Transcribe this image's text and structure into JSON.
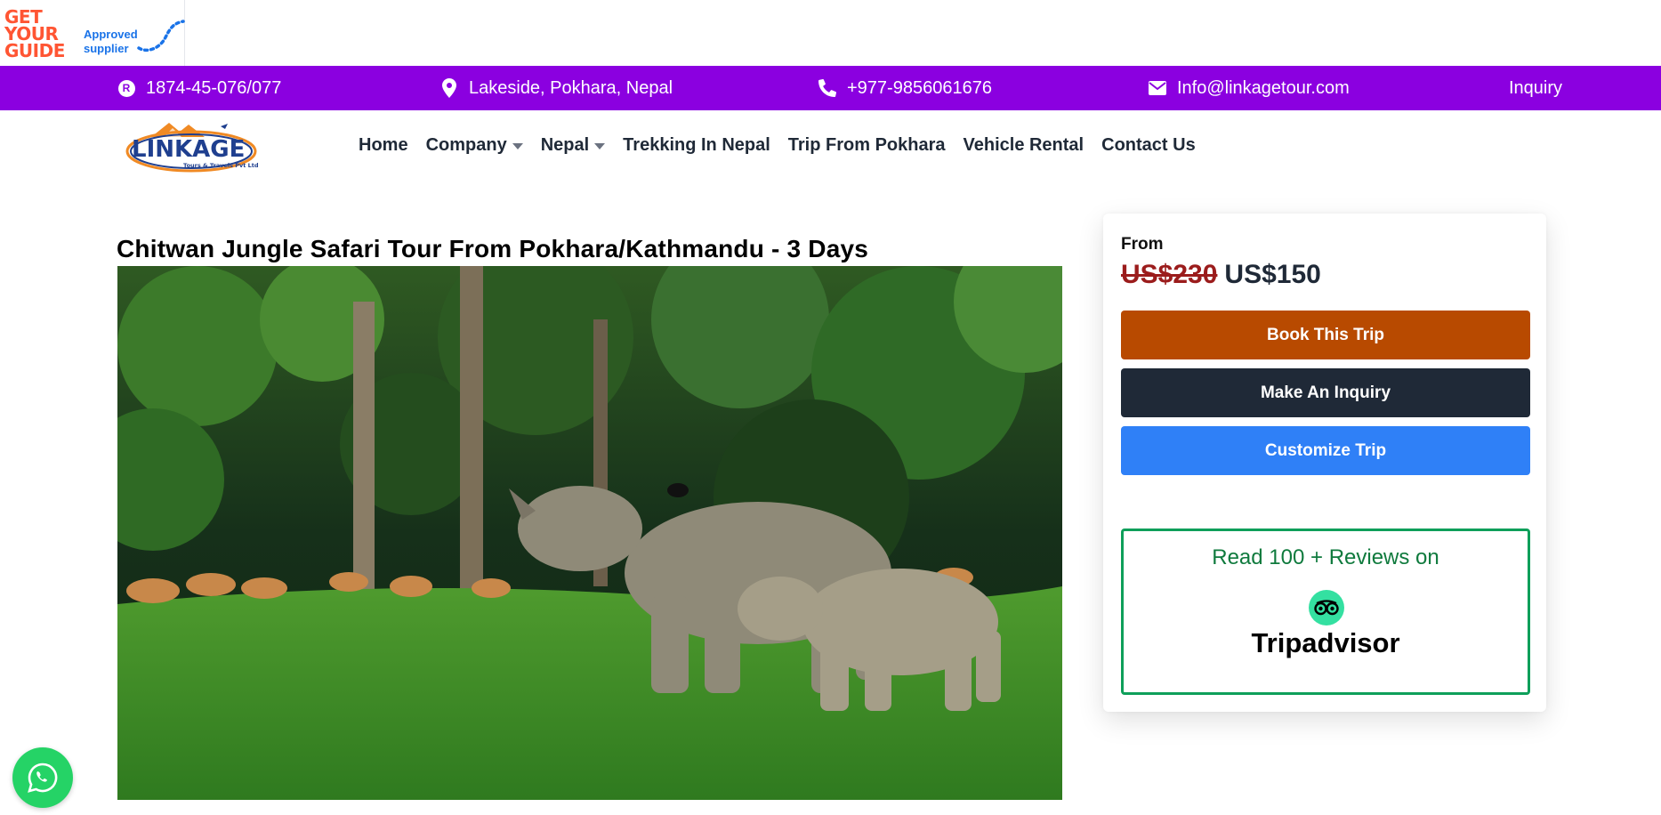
{
  "gyg": {
    "logo_text": "GET YOUR GUIDE",
    "approved_line1": "Approved",
    "approved_line2": "supplier"
  },
  "topbar": {
    "registration": "1874-45-076/077",
    "registration_icon": "registered-icon",
    "address": "Lakeside, Pokhara, Nepal",
    "phone": "+977-9856061676",
    "email": "Info@linkagetour.com",
    "inquiry": "Inquiry",
    "background_color": "#8b00e0"
  },
  "brand": {
    "name": "LINKAGE",
    "tagline": "Tours & Travels Pvt Ltd"
  },
  "nav": {
    "items": [
      {
        "label": "Home",
        "has_dropdown": false
      },
      {
        "label": "Company",
        "has_dropdown": true
      },
      {
        "label": "Nepal",
        "has_dropdown": true
      },
      {
        "label": "Trekking In Nepal",
        "has_dropdown": false
      },
      {
        "label": "Trip From Pokhara",
        "has_dropdown": false
      },
      {
        "label": "Vehicle Rental",
        "has_dropdown": false
      },
      {
        "label": "Contact Us",
        "has_dropdown": false
      }
    ]
  },
  "page": {
    "title": "Chitwan Jungle Safari Tour From Pokhara/Kathmandu - 3 Days",
    "hero_alt": "Rhinos and deer in Chitwan grassland"
  },
  "booking": {
    "from_label": "From",
    "old_price": "US$230",
    "new_price": "US$150",
    "book_label": "Book This Trip",
    "inquiry_label": "Make An Inquiry",
    "customize_label": "Customize Trip",
    "colors": {
      "book": "#b84a00",
      "inquiry": "#1f2937",
      "customize": "#2f80f7"
    }
  },
  "reviews": {
    "text": "Read 100 + Reviews on",
    "platform": "Tripadvisor"
  },
  "whatsapp": {
    "icon": "whatsapp-icon"
  }
}
